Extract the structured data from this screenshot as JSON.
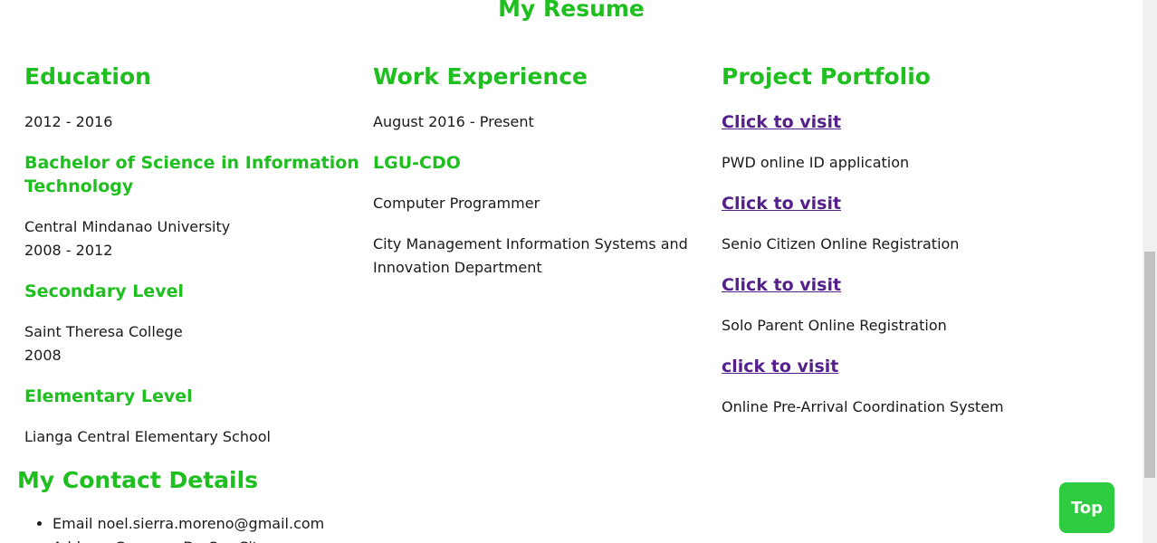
{
  "page": {
    "title": "My Resume"
  },
  "education": {
    "heading": "Education",
    "items": [
      {
        "years": "2012 - 2016"
      },
      {
        "degree": "Bachelor of Science in Information Technology",
        "school": "Central Mindanao University",
        "years": "2008 - 2012"
      },
      {
        "level": "Secondary Level",
        "school": "Saint Theresa College",
        "years": "2008"
      },
      {
        "level": "Elementary Level",
        "school": "Lianga Central Elementary School"
      }
    ]
  },
  "work": {
    "heading": "Work Experience",
    "period": "August 2016 - Present",
    "employer": "LGU-CDO",
    "position": "Computer Programmer",
    "department": "City Management Information Systems and Innovation Department"
  },
  "portfolio": {
    "heading": "Project Portfolio",
    "projects": [
      {
        "link": "Click to visit",
        "name": "PWD online ID application"
      },
      {
        "link": "Click to visit",
        "name": "Senio Citizen Online Registration"
      },
      {
        "link": "Click to visit",
        "name": "Solo Parent Online Registration"
      },
      {
        "link": "click to visit",
        "name": "Online Pre-Arrival Coordination System"
      }
    ]
  },
  "contact": {
    "heading": "My Contact Details",
    "items": [
      {
        "label": "Email noel.sierra.moreno@gmail.com"
      },
      {
        "label": "Address Cagayan De Oro City"
      }
    ]
  },
  "top_button": {
    "label": "Top"
  },
  "colors": {
    "heading_green": "#1fbf1f",
    "link_purple": "#55208c",
    "button_green": "#2ecc40"
  }
}
